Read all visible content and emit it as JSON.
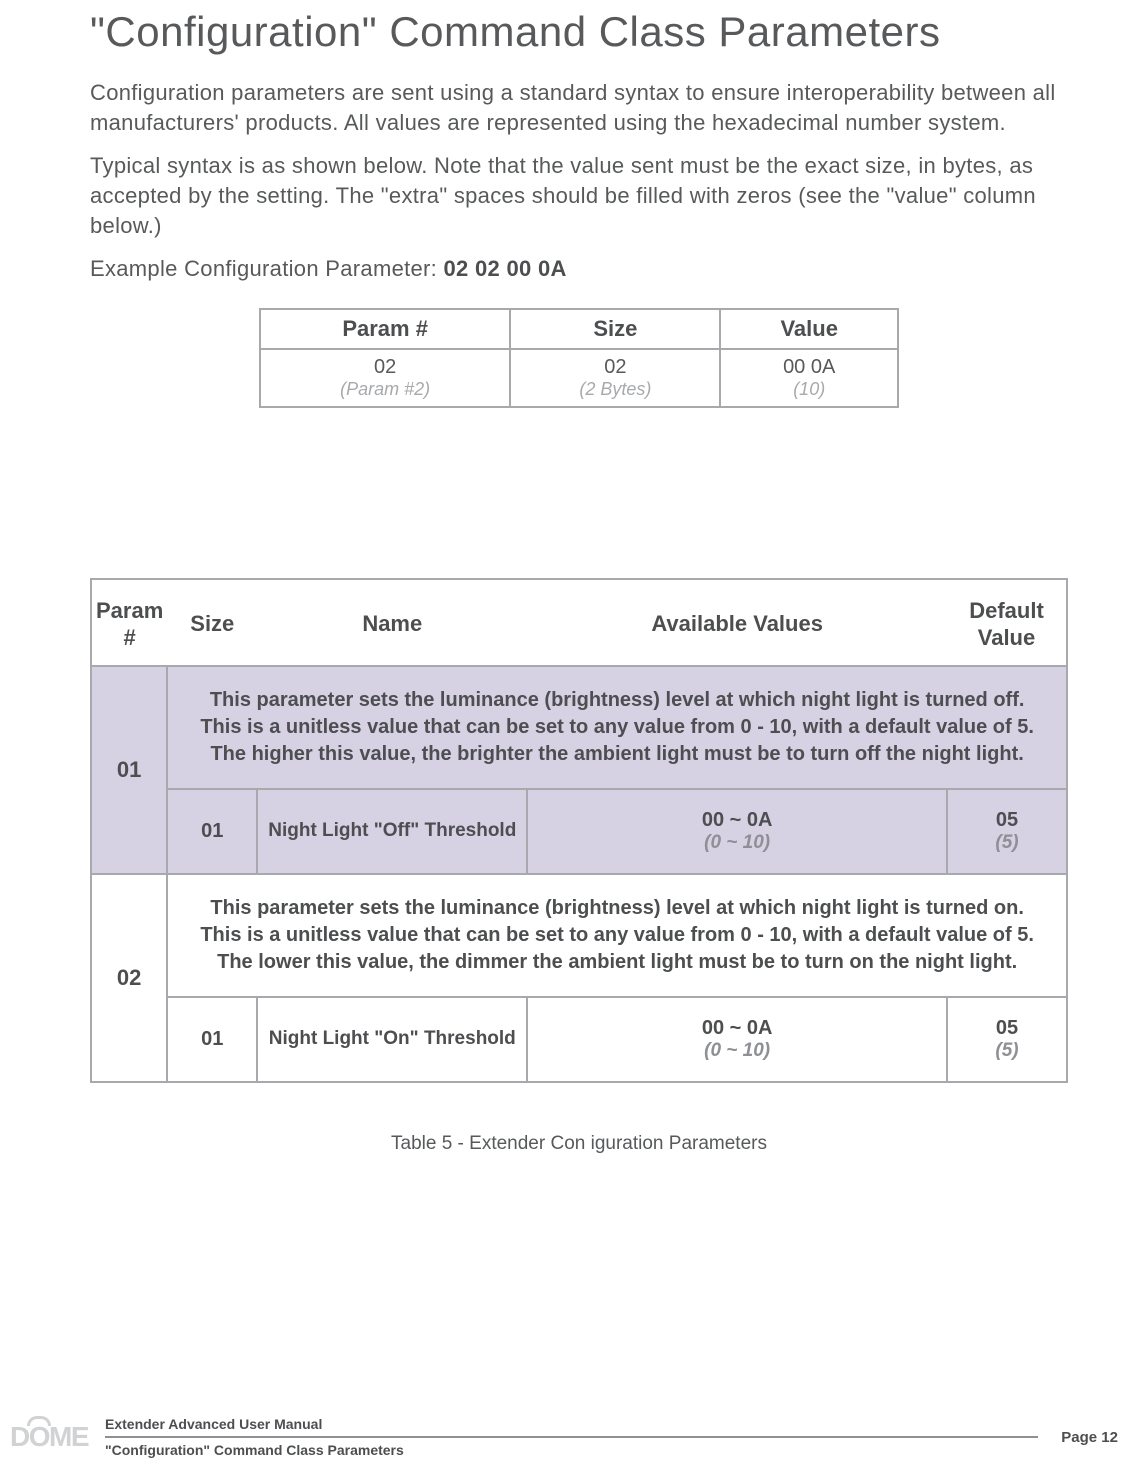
{
  "title": "\"Configuration\" Command Class Parameters",
  "para1": "Configuration parameters are sent using a standard syntax to ensure interoperability between all manufacturers' products.  All values are represented using the hexadecimal number system.",
  "para2": "Typical syntax is as shown below. Note that the value sent must be the exact size, in bytes, as accepted by the setting.  The \"extra\" spaces should be filled with zeros (see the \"value\" column below.)",
  "example_label": "Example Configuration Parameter: ",
  "example_value": "02 02 00 0A",
  "ex_table": {
    "headers": [
      "Param #",
      "Size",
      "Value"
    ],
    "row": [
      {
        "top": "02",
        "bot": "(Param #2)"
      },
      {
        "top": "02",
        "bot": "(2 Bytes)"
      },
      {
        "top": "00 0A",
        "bot": "(10)"
      }
    ]
  },
  "chart_data": {
    "type": "table",
    "title": "Extender Configuration Parameters",
    "columns": [
      "Param #",
      "Size",
      "Name",
      "Available Values",
      "Default Value"
    ],
    "rows": [
      {
        "param_num": "01",
        "description": "This parameter sets the luminance (brightness) level at which night light is turned off.  This is a unitless value that can be set to any value from 0 - 10, with a default value of 5.  The higher this value, the brighter the ambient light must be to turn off the night light.",
        "size": "01",
        "name": "Night Light \"Off\" Threshold",
        "available_hex": "00 ~ 0A",
        "available_dec": "(0 ~ 10)",
        "default_hex": "05",
        "default_dec": "(5)"
      },
      {
        "param_num": "02",
        "description": "This parameter sets the luminance (brightness) level at which night light is turned on.  This is a unitless value that can be set to any value from 0 - 10, with a default value of 5.  The lower this value, the dimmer the ambient light must be to turn on the night light.",
        "size": "01",
        "name": "Night Light \"On\" Threshold",
        "available_hex": "00 ~ 0A",
        "available_dec": "(0 ~ 10)",
        "default_hex": "05",
        "default_dec": "(5)"
      }
    ]
  },
  "caption": "Table 5 - Extender Con iguration Parameters",
  "footer": {
    "manual": "Extender Advanced User Manual",
    "section": "\"Configuration\" Command Class Parameters",
    "page": "Page 12",
    "logo": "DOME"
  }
}
